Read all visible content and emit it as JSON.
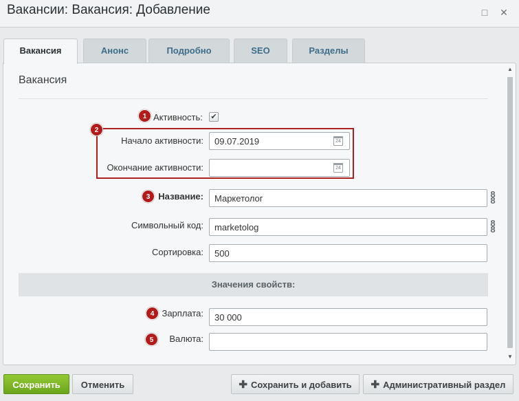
{
  "window": {
    "title": "Вакансии: Вакансия: Добавление",
    "maximize_icon": "□",
    "close_icon": "✕"
  },
  "tabs": [
    {
      "label": "Вакансия",
      "active": true
    },
    {
      "label": "Анонс",
      "active": false
    },
    {
      "label": "Подробно",
      "active": false
    },
    {
      "label": "SEO",
      "active": false
    },
    {
      "label": "Разделы",
      "active": false
    }
  ],
  "section": {
    "title": "Вакансия"
  },
  "fields": {
    "active": {
      "label": "Активность:",
      "checked": true,
      "badge": "1"
    },
    "date_group_badge": "2",
    "start": {
      "label": "Начало активности:",
      "value": "09.07.2019"
    },
    "end": {
      "label": "Окончание активности:",
      "value": ""
    },
    "name": {
      "label": "Название:",
      "value": "Маркетолог",
      "badge": "3"
    },
    "code": {
      "label": "Символьный код:",
      "value": "marketolog"
    },
    "sort": {
      "label": "Сортировка:",
      "value": "500"
    },
    "salary": {
      "label": "Зарплата:",
      "value": "30 000",
      "badge": "4"
    },
    "currency": {
      "label": "Валюта:",
      "value": "",
      "badge": "5"
    }
  },
  "properties_header": "Значения свойств:",
  "calendar_icon_text": "24",
  "buttons": {
    "save": "Сохранить",
    "cancel": "Отменить",
    "save_add": "Сохранить и добавить",
    "admin": "Административный раздел"
  },
  "colors": {
    "accent_green": "#7ab82a",
    "badge_red": "#b31b1b",
    "tab_link": "#3d6d8a"
  }
}
